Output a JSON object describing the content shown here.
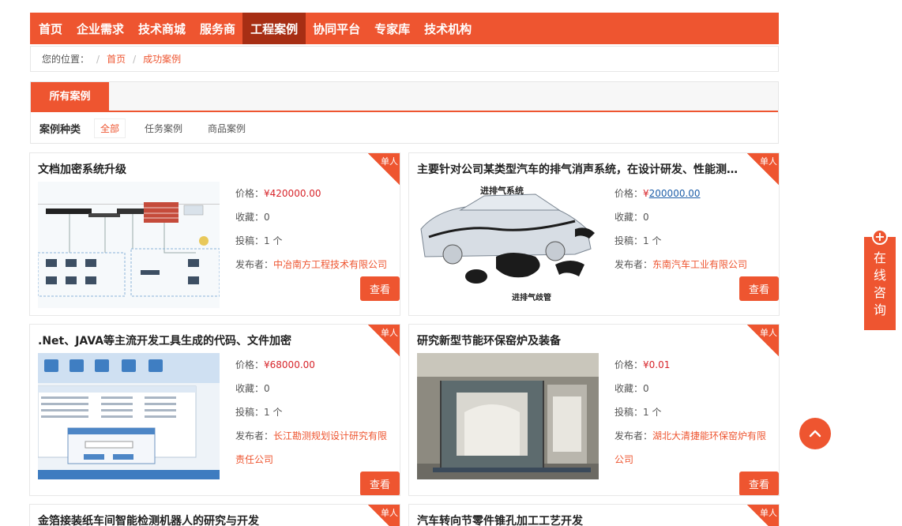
{
  "nav": {
    "items": [
      "首页",
      "企业需求",
      "技术商城",
      "服务商",
      "工程案例",
      "协同平台",
      "专家库",
      "技术机构"
    ],
    "active_index": 4
  },
  "breadcrumb": {
    "label": "您的位置：",
    "sep": "/",
    "items": [
      "首页",
      "成功案例"
    ]
  },
  "filter": {
    "tab": "所有案例",
    "type_label": "案例种类",
    "options": [
      "全部",
      "任务案例",
      "商品案例"
    ],
    "selected": "全部"
  },
  "labels": {
    "price": "价格：",
    "collect": "收藏：",
    "submissions": "投稿：",
    "publisher": "发布者：",
    "view": "查看",
    "badge": "单人"
  },
  "cards": [
    {
      "title": "文档加密系统升级",
      "price": "¥420000.00",
      "collect": "0",
      "submissions": "1 个",
      "publisher": "中冶南方工程技术有限公司",
      "image": "network-diagram"
    },
    {
      "title": "主要针对公司某类型汽车的排气消声系统，在设计研发、性能测试...",
      "price_symbol": "¥",
      "price_link": "200000.00",
      "collect": "0",
      "submissions": "1 个",
      "publisher": "东南汽车工业有限公司",
      "image": "car-exhaust-diagram",
      "image_text": [
        "进排气系统",
        "进排气歧管"
      ]
    },
    {
      "title": ".Net、JAVA等主流开发工具生成的代码、文件加密",
      "price": "¥68000.00",
      "collect": "0",
      "submissions": "1 个",
      "publisher_line1": "长江勘测规划设计研究有限",
      "publisher_line2": "责任公司",
      "image": "software-screenshot"
    },
    {
      "title": "研究新型节能环保窑炉及装备",
      "price": "¥0.01",
      "collect": "0",
      "submissions": "1 个",
      "publisher_line1": "湖北大清捷能环保窑炉有限",
      "publisher_line2": "公司",
      "image": "kiln-photo"
    },
    {
      "title": "金箔接装纸车间智能检测机器人的研究与开发"
    },
    {
      "title": "汽车转向节零件锥孔加工工艺开发"
    }
  ],
  "side": {
    "consult": "在线咨询",
    "icons": [
      "plus-circle-icon",
      "chevron-up-icon"
    ]
  },
  "colors": {
    "accent": "#ee5530",
    "nav_active": "#a72e14",
    "price": "#d7242a",
    "link": "#1f5fa9"
  }
}
